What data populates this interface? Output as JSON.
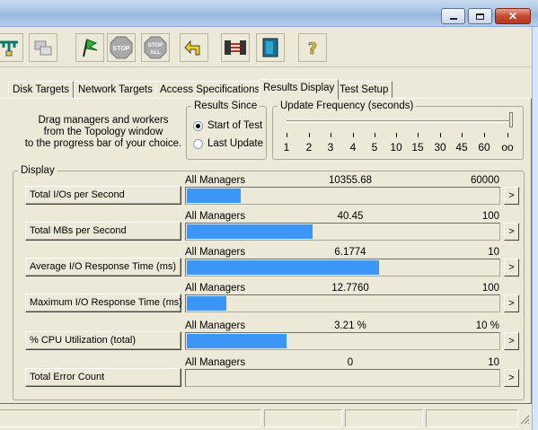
{
  "window": {
    "minimize_icon": "minimize-icon",
    "maximize_icon": "maximize-icon",
    "close_label": "✕"
  },
  "toolbar": {
    "buttons": [
      {
        "icon": "topology-icon"
      },
      {
        "icon": "copy-worker-icon"
      },
      {
        "icon": "start-flag-icon"
      },
      {
        "icon": "stop-icon",
        "label": "STOP"
      },
      {
        "icon": "stop-all-icon",
        "label": "STOP ALL"
      },
      {
        "icon": "reset-icon"
      },
      {
        "icon": "workers-icon"
      },
      {
        "icon": "exit-icon"
      },
      {
        "icon": "help-icon",
        "label": "?"
      }
    ]
  },
  "tabs": [
    {
      "label": "Disk Targets"
    },
    {
      "label": "Network Targets"
    },
    {
      "label": "Access Specifications"
    },
    {
      "label": "Results Display",
      "active": true
    },
    {
      "label": "Test Setup"
    }
  ],
  "hint_lines": [
    "Drag managers and workers",
    "from the Topology window",
    "to the progress bar of your choice."
  ],
  "results_since": {
    "title": "Results Since",
    "options": [
      {
        "label": "Start of Test",
        "selected": true
      },
      {
        "label": "Last Update",
        "selected": false
      }
    ]
  },
  "update_frequency": {
    "title": "Update Frequency (seconds)",
    "ticks": [
      "1",
      "2",
      "3",
      "4",
      "5",
      "10",
      "15",
      "30",
      "45",
      "60",
      "oo"
    ],
    "selected": "oo"
  },
  "display": {
    "title": "Display",
    "rows": [
      {
        "button": "Total I/Os per Second",
        "source": "All Managers",
        "value": "10355.68",
        "max": "60000",
        "fill": 0.1726
      },
      {
        "button": "Total MBs per Second",
        "source": "All Managers",
        "value": "40.45",
        "max": "100",
        "fill": 0.4045
      },
      {
        "button": "Average I/O Response Time (ms)",
        "source": "All Managers",
        "value": "6.1774",
        "max": "10",
        "fill": 0.6177
      },
      {
        "button": "Maximum I/O Response Time (ms)",
        "source": "All Managers",
        "value": "12.7760",
        "max": "100",
        "fill": 0.1278
      },
      {
        "button": "% CPU Utilization (total)",
        "source": "All Managers",
        "value": "3.21 %",
        "max": "10 %",
        "fill": 0.321
      },
      {
        "button": "Total Error Count",
        "source": "All Managers",
        "value": "0",
        "max": "10",
        "fill": 0
      }
    ],
    "arrow_label": ">"
  },
  "colors": {
    "bar": "#3b96f5",
    "face": "#ece9d8"
  }
}
